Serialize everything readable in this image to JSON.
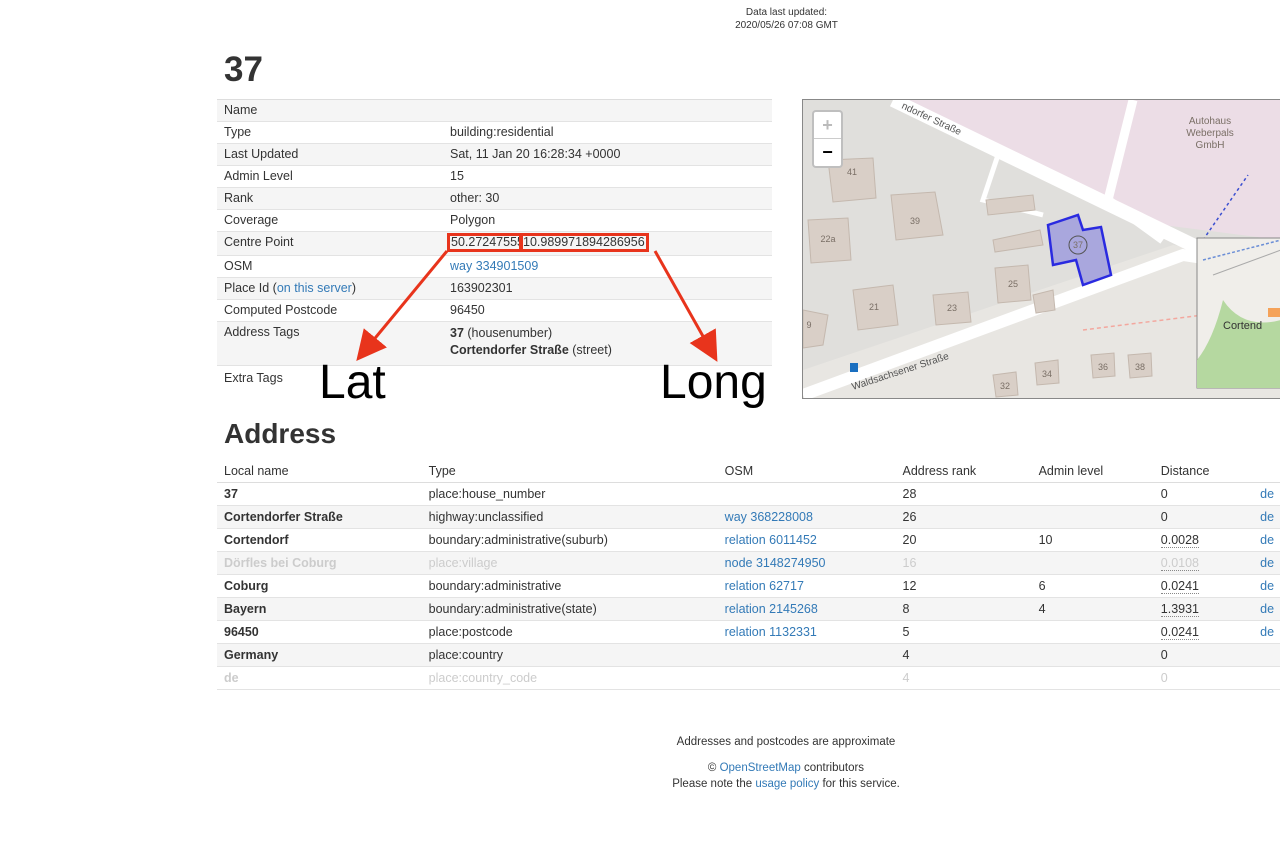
{
  "header": {
    "updated_label": "Data last updated:",
    "updated_value": "2020/05/26 07:08 GMT"
  },
  "title": "37",
  "details": {
    "name_label": "Name",
    "type_label": "Type",
    "type_value": "building:residential",
    "last_updated_label": "Last Updated",
    "last_updated_value": "Sat, 11 Jan 20 16:28:34 +0000",
    "admin_level_label": "Admin Level",
    "admin_level_value": "15",
    "rank_label": "Rank",
    "rank_value": "other: 30",
    "coverage_label": "Coverage",
    "coverage_value": "Polygon",
    "centre_label": "Centre Point",
    "centre_lat": "50.27247555",
    "centre_lon": "10.989971894286956",
    "osm_label": "OSM",
    "osm_value": "way 334901509",
    "place_id_label_pre": "Place Id (",
    "place_id_link": "on this server",
    "place_id_label_post": ")",
    "place_id_value": "163902301",
    "postcode_label": "Computed Postcode",
    "postcode_value": "96450",
    "address_tags_label": "Address Tags",
    "tag1_value": "37",
    "tag1_key": "(housenumber)",
    "tag2_value": "Cortendorfer Straße",
    "tag2_key": "(street)",
    "extra_tags_label": "Extra Tags"
  },
  "annotations": {
    "lat": "Lat",
    "long": "Long",
    "color": "#e8341c"
  },
  "map": {
    "zoom_in": "+",
    "zoom_out": "−",
    "street1": "ndorfer Straße",
    "street2": "Waldsachsener Straße",
    "poi": "Autohaus Weberpals GmbH",
    "poi_line1": "Autohaus",
    "poi_line2": "Weberpals",
    "poi_line3": "GmbH",
    "houses": [
      "41",
      "39",
      "22a",
      "37",
      "25",
      "21",
      "23",
      "9",
      "32",
      "34",
      "36",
      "38"
    ],
    "minimap_label": "Cortend"
  },
  "address": {
    "title": "Address",
    "columns": [
      "Local name",
      "Type",
      "OSM",
      "Address rank",
      "Admin level",
      "Distance",
      ""
    ],
    "rows": [
      {
        "name": "37",
        "type": "place:house_number",
        "osm": "",
        "rank": "28",
        "admin": "",
        "distance": "0",
        "link": "de",
        "faded": false,
        "dotted": false
      },
      {
        "name": "Cortendorfer Straße",
        "type": "highway:unclassified",
        "osm": "way 368228008",
        "rank": "26",
        "admin": "",
        "distance": "0",
        "link": "de",
        "faded": false,
        "dotted": false
      },
      {
        "name": "Cortendorf",
        "type": "boundary:administrative(suburb)",
        "osm": "relation 6011452",
        "rank": "20",
        "admin": "10",
        "distance": "0.0028",
        "link": "de",
        "faded": false,
        "dotted": true
      },
      {
        "name": "Dörfles bei Coburg",
        "type": "place:village",
        "osm": "node 3148274950",
        "rank": "16",
        "admin": "",
        "distance": "0.0108",
        "link": "de",
        "faded": true,
        "dotted": true
      },
      {
        "name": "Coburg",
        "type": "boundary:administrative",
        "osm": "relation 62717",
        "rank": "12",
        "admin": "6",
        "distance": "0.0241",
        "link": "de",
        "faded": false,
        "dotted": true
      },
      {
        "name": "Bayern",
        "type": "boundary:administrative(state)",
        "osm": "relation 2145268",
        "rank": "8",
        "admin": "4",
        "distance": "1.3931",
        "link": "de",
        "faded": false,
        "dotted": true
      },
      {
        "name": "96450",
        "type": "place:postcode",
        "osm": "relation 1132331",
        "rank": "5",
        "admin": "",
        "distance": "0.0241",
        "link": "de",
        "faded": false,
        "dotted": true
      },
      {
        "name": "Germany",
        "type": "place:country",
        "osm": "",
        "rank": "4",
        "admin": "",
        "distance": "0",
        "link": "",
        "faded": false,
        "dotted": false
      },
      {
        "name": "de",
        "type": "place:country_code",
        "osm": "",
        "rank": "4",
        "admin": "",
        "distance": "0",
        "link": "",
        "faded": true,
        "dotted": false
      }
    ]
  },
  "footer": {
    "approx": "Addresses and postcodes are approximate",
    "copyright_pre": "© ",
    "osm_link": "OpenStreetMap",
    "copyright_post": " contributors",
    "usage_pre": "Please note the ",
    "usage_link": "usage policy",
    "usage_post": " for this service."
  }
}
